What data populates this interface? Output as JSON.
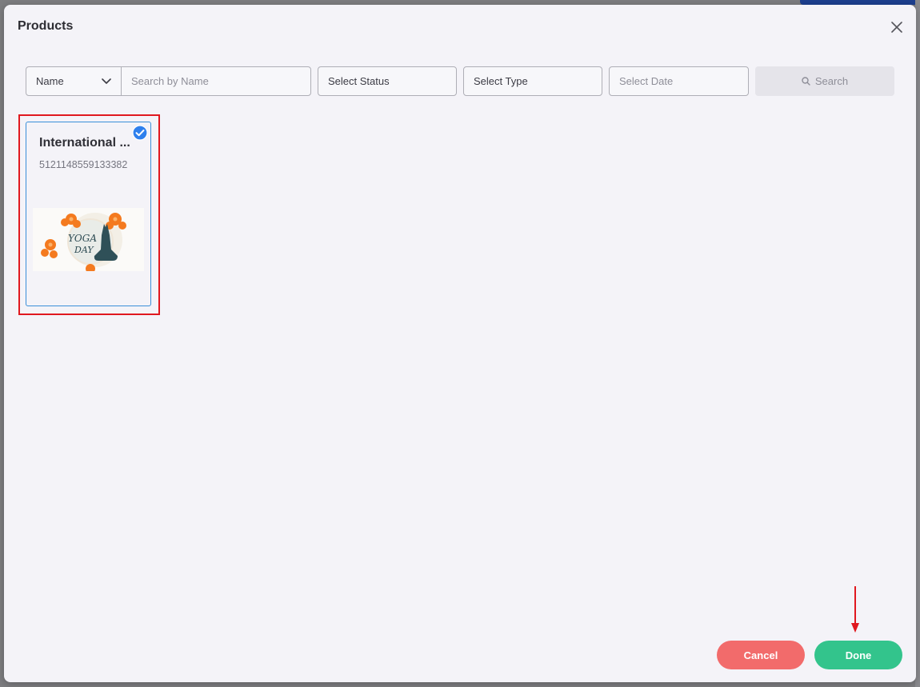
{
  "modal": {
    "title": "Products"
  },
  "filters": {
    "name_select_value": "Name",
    "search_placeholder": "Search by Name",
    "status_placeholder": "Select Status",
    "type_placeholder": "Select Type",
    "date_placeholder": "Select Date",
    "search_button_label": "Search"
  },
  "products": [
    {
      "title": "International ...",
      "id": "5121148559133382",
      "selected": true,
      "image_icon": "yoga-day-image"
    }
  ],
  "footer": {
    "cancel_label": "Cancel",
    "done_label": "Done"
  },
  "icons": {
    "close": "close-icon",
    "chevron": "chevron-down-icon",
    "search": "search-icon",
    "check": "check-circle-icon",
    "arrow": "arrow-down-icon"
  },
  "colors": {
    "accent_blue": "#2f80ed",
    "cancel": "#f26b6b",
    "done": "#33c48c",
    "highlight": "#e0181f"
  }
}
